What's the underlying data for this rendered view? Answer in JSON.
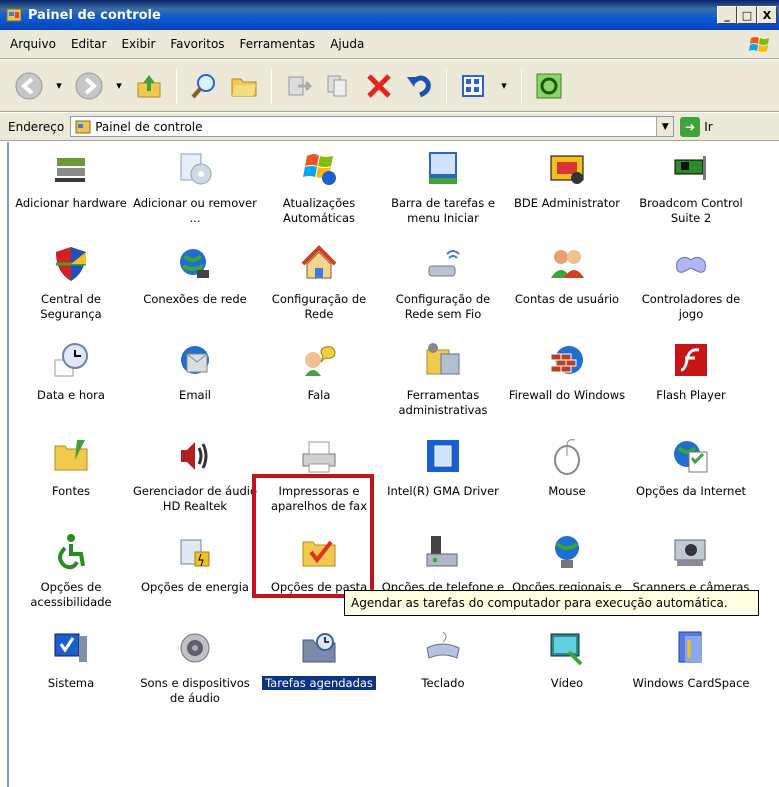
{
  "window": {
    "title": "Painel de controle",
    "buttons": [
      "_",
      "□",
      "X"
    ]
  },
  "menu": [
    {
      "label": "Arquivo"
    },
    {
      "label": "Editar"
    },
    {
      "label": "Exibir"
    },
    {
      "label": "Favoritos"
    },
    {
      "label": "Ferramentas"
    },
    {
      "label": "Ajuda"
    }
  ],
  "toolbar": {
    "icons": [
      "back-icon",
      "forward-icon",
      "up-folder-icon",
      "search-icon",
      "folders-icon",
      "move-to-icon",
      "copy-to-icon",
      "delete-icon",
      "undo-icon",
      "views-icon",
      "sync-icon"
    ]
  },
  "address": {
    "label": "Endereço",
    "value": "Painel de controle",
    "go_label": "Ir"
  },
  "items": [
    {
      "label": "Adicionar hardware",
      "icon": "hardware-icon"
    },
    {
      "label": "Adicionar ou remover ...",
      "icon": "add-remove-programs-icon"
    },
    {
      "label": "Atualizações Automáticas",
      "icon": "automatic-updates-icon"
    },
    {
      "label": "Barra de tarefas e menu Iniciar",
      "icon": "taskbar-icon"
    },
    {
      "label": "BDE Administrator",
      "icon": "bde-icon"
    },
    {
      "label": "Broadcom Control Suite 2",
      "icon": "network-card-icon"
    },
    {
      "label": "Central de Segurança",
      "icon": "security-shield-icon"
    },
    {
      "label": "Conexões de rede",
      "icon": "network-globe-icon"
    },
    {
      "label": "Configuração de Rede",
      "icon": "home-network-icon"
    },
    {
      "label": "Configuração de Rede sem Fio",
      "icon": "wireless-icon"
    },
    {
      "label": "Contas de usuário",
      "icon": "users-icon"
    },
    {
      "label": "Controladores de jogo",
      "icon": "gamepad-icon"
    },
    {
      "label": "Data e hora",
      "icon": "clock-icon"
    },
    {
      "label": "Email",
      "icon": "email-icon"
    },
    {
      "label": "Fala",
      "icon": "speech-icon"
    },
    {
      "label": "Ferramentas administrativas",
      "icon": "admin-tools-icon"
    },
    {
      "label": "Firewall do Windows",
      "icon": "firewall-icon"
    },
    {
      "label": "Flash Player",
      "icon": "flash-icon"
    },
    {
      "label": "Fontes",
      "icon": "fonts-folder-icon"
    },
    {
      "label": "Gerenciador de áudio HD Realtek",
      "icon": "speaker-icon"
    },
    {
      "label": "Impressoras e aparelhos de fax",
      "icon": "printer-icon"
    },
    {
      "label": "Intel(R) GMA Driver",
      "icon": "intel-gma-icon"
    },
    {
      "label": "Mouse",
      "icon": "mouse-icon"
    },
    {
      "label": "Opções da Internet",
      "icon": "internet-options-icon"
    },
    {
      "label": "Opções de acessibilidade",
      "icon": "accessibility-icon"
    },
    {
      "label": "Opções de energia",
      "icon": "power-icon"
    },
    {
      "label": "Opções de pasta",
      "icon": "folder-options-icon"
    },
    {
      "label": "Opções de telefone e modem",
      "icon": "phone-modem-icon"
    },
    {
      "label": "Opções regionais e de idioma",
      "icon": "regional-globe-icon"
    },
    {
      "label": "Scanners e câmeras",
      "icon": "scanner-camera-icon"
    },
    {
      "label": "Sistema",
      "icon": "system-icon"
    },
    {
      "label": "Sons e dispositivos de áudio",
      "icon": "sound-icon"
    },
    {
      "label": "Tarefas agendadas",
      "icon": "scheduled-tasks-icon",
      "selected": true
    },
    {
      "label": "Teclado",
      "icon": "keyboard-icon"
    },
    {
      "label": "Vídeo",
      "icon": "video-icon"
    },
    {
      "label": "Windows CardSpace",
      "icon": "cardspace-icon"
    }
  ],
  "tooltip": "Agendar as tarefas do computador para execução automática.",
  "colors": {
    "title_bar": "#0a58d6",
    "selection": "#0b3289",
    "highlight_box": "#c0141b",
    "tooltip_bg": "#ffffe1"
  }
}
